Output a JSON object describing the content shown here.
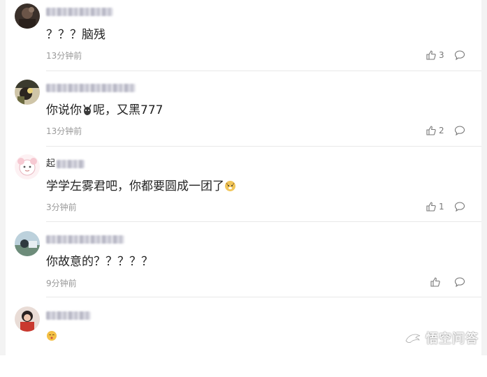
{
  "comments": [
    {
      "username_partial": "",
      "text": "？？？脑残",
      "time": "13分钟前",
      "likes": "3"
    },
    {
      "username_partial": "",
      "text_before": "你说你",
      "text_after": "呢，又黑777",
      "time": "13分钟前",
      "likes": "2"
    },
    {
      "username_partial": "起",
      "text": "学学左雾君吧，你都要圆成一团了",
      "time": "3分钟前",
      "likes": "1"
    },
    {
      "username_partial": "",
      "text": "你故意的？？？？？",
      "time": "9分钟前",
      "likes": ""
    },
    {
      "username_partial": "",
      "text": "",
      "time": "",
      "likes": ""
    }
  ],
  "watermark": {
    "text": "悟空问答",
    "icon": "wukong-logo-icon"
  },
  "icons": {
    "like": "thumbs-up-icon",
    "reply": "comment-bubble-icon"
  },
  "colors": {
    "text": "#222222",
    "meta": "#999999",
    "divider": "#e8e8e8"
  }
}
